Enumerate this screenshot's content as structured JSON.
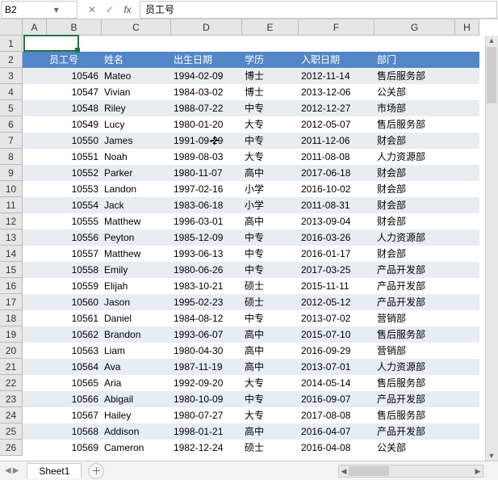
{
  "formula_bar": {
    "cell_ref": "B2",
    "cancel": "✕",
    "confirm": "✓",
    "fx": "fx",
    "value": "员工号"
  },
  "columns": [
    "A",
    "B",
    "C",
    "D",
    "E",
    "F",
    "G",
    "H"
  ],
  "row_count": 26,
  "header_row": 2,
  "headers": [
    "员工号",
    "姓名",
    "出生日期",
    "学历",
    "入职日期",
    "部门"
  ],
  "chart_data": {
    "type": "table",
    "columns": [
      "员工号",
      "姓名",
      "出生日期",
      "学历",
      "入职日期",
      "部门"
    ],
    "rows": [
      [
        10546,
        "Mateo",
        "1994-02-09",
        "博士",
        "2012-11-14",
        "售后服务部"
      ],
      [
        10547,
        "Vivian",
        "1984-03-02",
        "博士",
        "2013-12-06",
        "公关部"
      ],
      [
        10548,
        "Riley",
        "1988-07-22",
        "中专",
        "2012-12-27",
        "市场部"
      ],
      [
        10549,
        "Lucy",
        "1980-01-20",
        "大专",
        "2012-05-07",
        "售后服务部"
      ],
      [
        10550,
        "James",
        "1991-09-29",
        "中专",
        "2011-12-06",
        "财会部"
      ],
      [
        10551,
        "Noah",
        "1989-08-03",
        "大专",
        "2011-08-08",
        "人力资源部"
      ],
      [
        10552,
        "Parker",
        "1980-11-07",
        "高中",
        "2017-06-18",
        "财会部"
      ],
      [
        10553,
        "Landon",
        "1997-02-16",
        "小学",
        "2016-10-02",
        "财会部"
      ],
      [
        10554,
        "Jack",
        "1983-06-18",
        "小学",
        "2011-08-31",
        "财会部"
      ],
      [
        10555,
        "Matthew",
        "1996-03-01",
        "高中",
        "2013-09-04",
        "财会部"
      ],
      [
        10556,
        "Peyton",
        "1985-12-09",
        "中专",
        "2016-03-26",
        "人力资源部"
      ],
      [
        10557,
        "Matthew",
        "1993-06-13",
        "中专",
        "2016-01-17",
        "财会部"
      ],
      [
        10558,
        "Emily",
        "1980-06-26",
        "中专",
        "2017-03-25",
        "产品开发部"
      ],
      [
        10559,
        "Elijah",
        "1983-10-21",
        "硕士",
        "2015-11-11",
        "产品开发部"
      ],
      [
        10560,
        "Jason",
        "1995-02-23",
        "硕士",
        "2012-05-12",
        "产品开发部"
      ],
      [
        10561,
        "Daniel",
        "1984-08-12",
        "中专",
        "2013-07-02",
        "营销部"
      ],
      [
        10562,
        "Brandon",
        "1993-06-07",
        "高中",
        "2015-07-10",
        "售后服务部"
      ],
      [
        10563,
        "Liam",
        "1980-04-30",
        "高中",
        "2016-09-29",
        "营销部"
      ],
      [
        10564,
        "Ava",
        "1987-11-19",
        "高中",
        "2013-07-01",
        "人力资源部"
      ],
      [
        10565,
        "Aria",
        "1992-09-20",
        "大专",
        "2014-05-14",
        "售后服务部"
      ],
      [
        10566,
        "Abigail",
        "1980-10-09",
        "中专",
        "2016-09-07",
        "产品开发部"
      ],
      [
        10567,
        "Hailey",
        "1980-07-27",
        "大专",
        "2017-08-08",
        "售后服务部"
      ],
      [
        10568,
        "Addison",
        "1998-01-21",
        "高中",
        "2016-04-07",
        "产品开发部"
      ],
      [
        10569,
        "Cameron",
        "1982-12-24",
        "硕士",
        "2016-04-08",
        "公关部"
      ]
    ]
  },
  "sheet_tabs": {
    "active": "Sheet1"
  },
  "cursor_plus": "✛",
  "active_cell": {
    "row": 2,
    "col": "B"
  }
}
